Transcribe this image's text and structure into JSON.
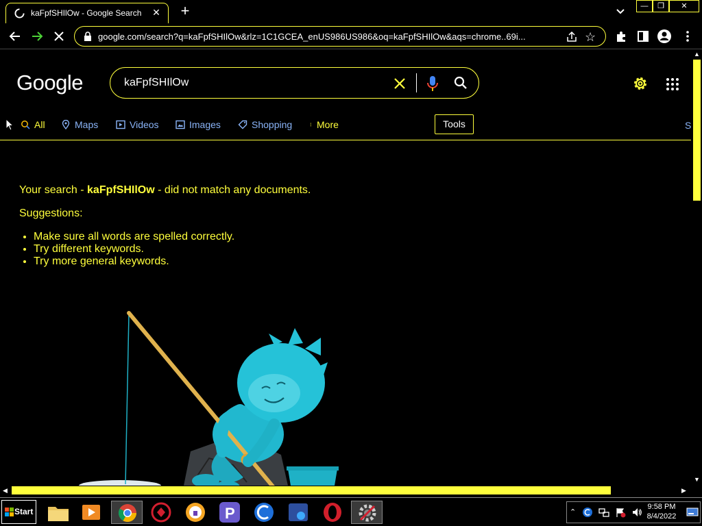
{
  "browser": {
    "tab_title": "kaFpfSHIlOw - Google Search",
    "url": "google.com/search?q=kaFpfSHIlOw&rlz=1C1GCEA_enUS986US986&oq=kaFpfSHIlOw&aqs=chrome..69i..."
  },
  "google": {
    "logo": "Google",
    "query": "kaFpfSHIlOw",
    "tabs": [
      {
        "label": "All"
      },
      {
        "label": "Maps"
      },
      {
        "label": "Videos"
      },
      {
        "label": "Images"
      },
      {
        "label": "Shopping"
      },
      {
        "label": "More"
      }
    ],
    "tools_label": "Tools",
    "cut_off_label": "S"
  },
  "results": {
    "prefix": "Your search - ",
    "query_bold": "kaFpfSHIlOw",
    "suffix": " - did not match any documents.",
    "suggestions_title": "Suggestions:",
    "suggestions": [
      "Make sure all words are spelled correctly.",
      "Try different keywords.",
      "Try more general keywords."
    ]
  },
  "taskbar": {
    "start_label": "Start",
    "time": "9:58 PM",
    "date": "8/4/2022"
  },
  "colors": {
    "accent": "#ffff3c",
    "link": "#8ab4f8",
    "background": "#000000"
  }
}
